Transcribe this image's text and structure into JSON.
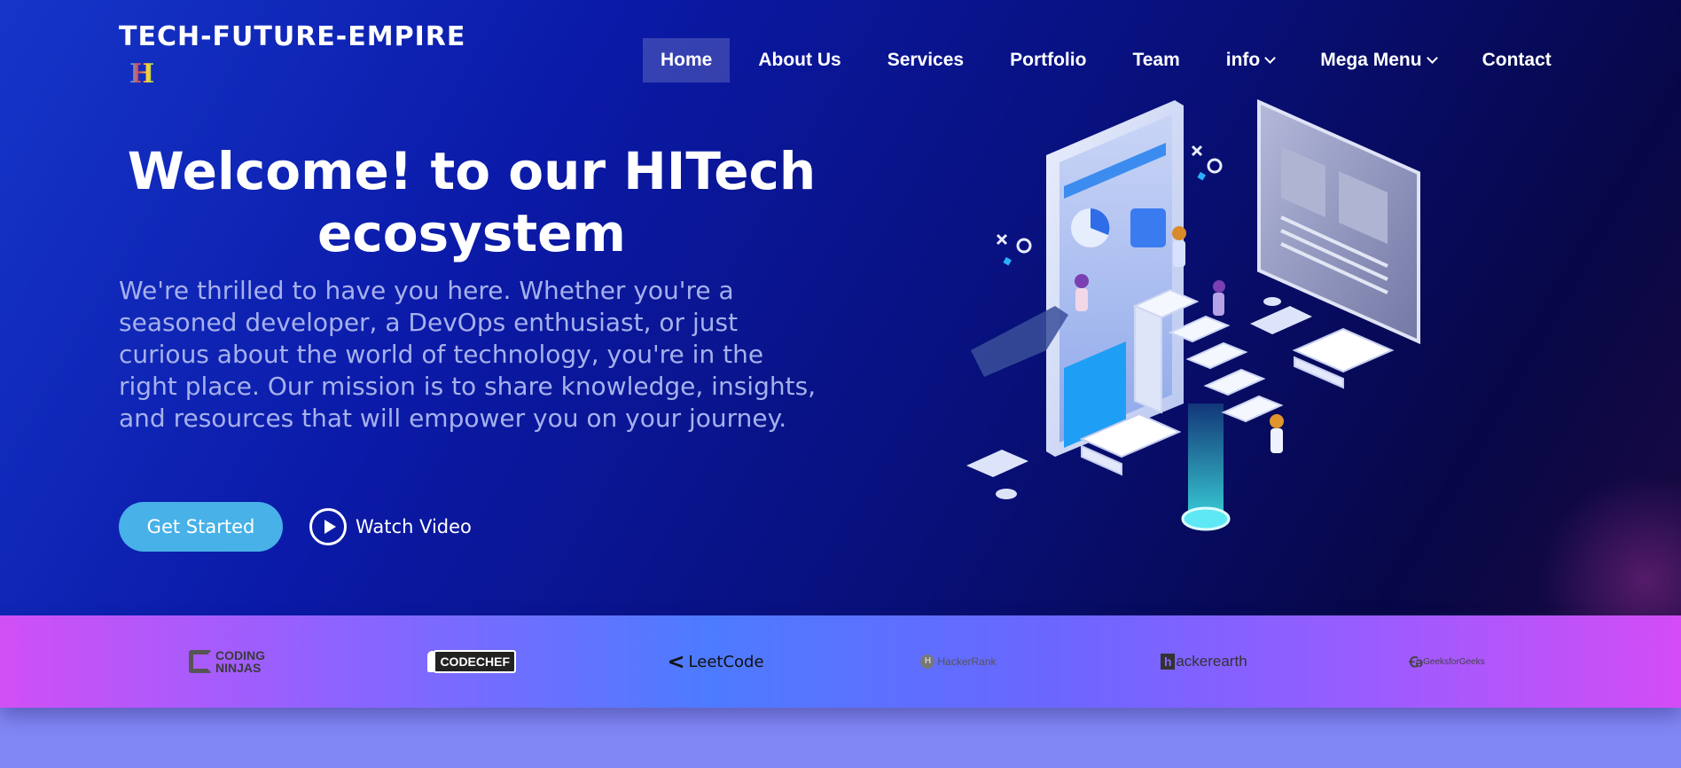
{
  "header": {
    "brand": "TECH-FUTURE-EMPIRE",
    "logo_mark": "H"
  },
  "nav": {
    "items": [
      {
        "label": "Home",
        "active": true
      },
      {
        "label": "About Us"
      },
      {
        "label": "Services"
      },
      {
        "label": "Portfolio"
      },
      {
        "label": "Team"
      },
      {
        "label": "info",
        "dropdown": true
      },
      {
        "label": "Mega Menu",
        "dropdown": true
      },
      {
        "label": "Contact"
      }
    ]
  },
  "hero": {
    "title_line1": "Welcome! to our HITech",
    "title_line2": "ecosystem",
    "description": "We're thrilled to have you here. Whether you're a seasoned developer, a DevOps enthusiast, or just curious about the world of technology, you're in the right place. Our mission is to share knowledge, insights, and resources that will empower you on your journey.",
    "cta_label": "Get Started",
    "video_label": "Watch Video",
    "illustration": "isometric-tech-illustration"
  },
  "brands": {
    "coding_ninjas": "CODING NINJAS",
    "coding_ninjas_line1": "CODING",
    "coding_ninjas_line2": "NINJAS",
    "codechef": "CODECHEF",
    "leetcode": "LeetCode",
    "hackerrank": "HackerRank",
    "hackerearth": "hackerearth",
    "hackerearth_rest": "ackerearth",
    "geeksforgeeks": "GeeksforGeeks"
  },
  "colors": {
    "hero_start": "#1536c9",
    "hero_end": "#070748",
    "cta": "#47b1e8",
    "brand_bar_start": "#d14ff5",
    "brand_bar_mid": "#4d7bff"
  }
}
